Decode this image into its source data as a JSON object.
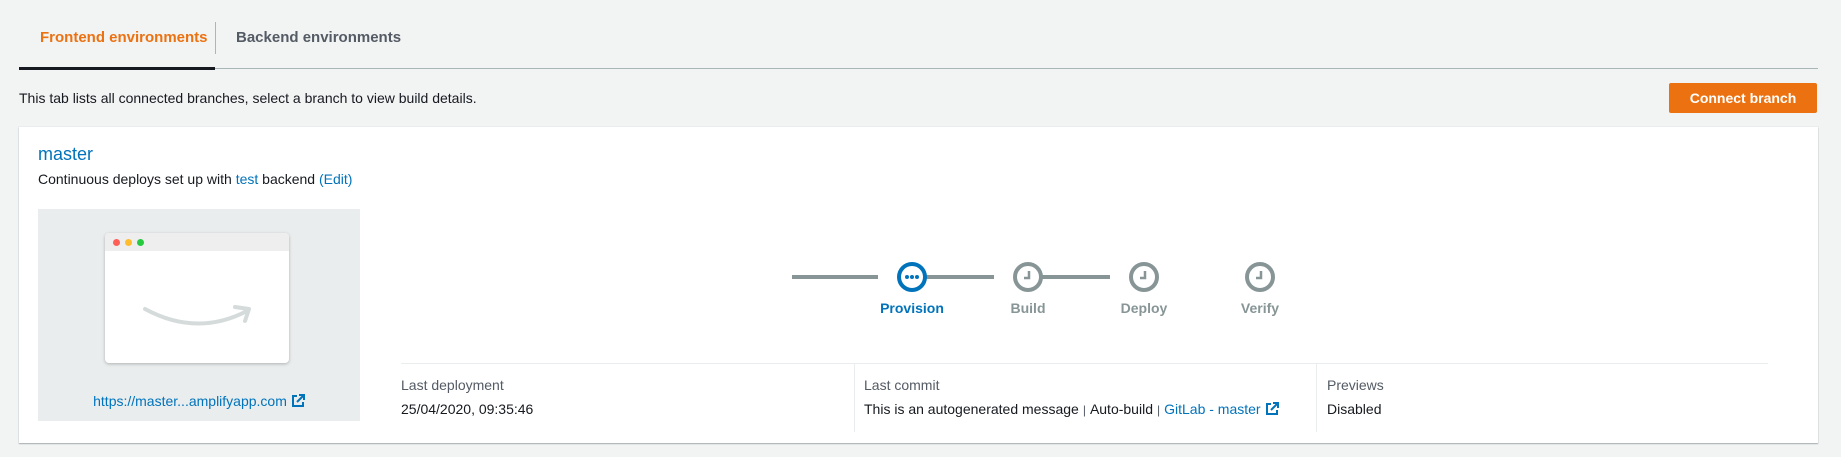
{
  "tabs": [
    {
      "label": "Frontend environments",
      "active": true
    },
    {
      "label": "Backend environments",
      "active": false
    }
  ],
  "intro_text": "This tab lists all connected branches, select a branch to view build details.",
  "connect_button_label": "Connect branch",
  "branch": {
    "name": "master",
    "desc_prefix": "Continuous deploys set up with",
    "backend_name": "test",
    "desc_suffix": "backend",
    "edit_label": "(Edit)",
    "preview_url": "https://master...amplifyapp.com"
  },
  "steps": [
    {
      "label": "Provision",
      "status": "in-progress",
      "icon": "ellipsis-icon"
    },
    {
      "label": "Build",
      "status": "pending",
      "icon": "clock-icon"
    },
    {
      "label": "Deploy",
      "status": "pending",
      "icon": "clock-icon"
    },
    {
      "label": "Verify",
      "status": "pending",
      "icon": "clock-icon"
    }
  ],
  "last_deployment": {
    "label": "Last deployment",
    "value": "25/04/2020, 09:35:46"
  },
  "last_commit": {
    "label": "Last commit",
    "message": "This is an autogenerated message",
    "trigger": "Auto-build",
    "repo_link": "GitLab - master"
  },
  "previews": {
    "label": "Previews",
    "value": "Disabled"
  },
  "colors": {
    "accent": "#ec7211",
    "link": "#0073bb",
    "pending": "#879596"
  }
}
